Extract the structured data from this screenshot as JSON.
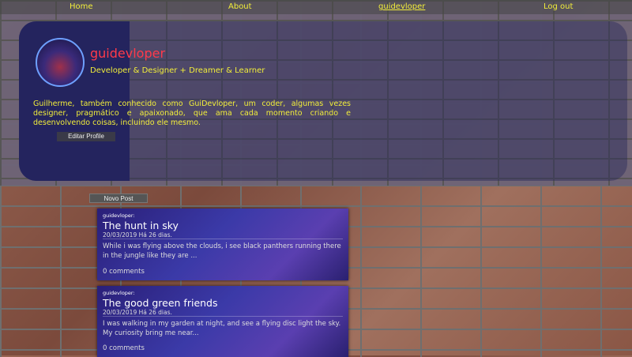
{
  "nav": {
    "items": [
      {
        "label": "Home"
      },
      {
        "label": "About"
      },
      {
        "label": "guidevloper"
      },
      {
        "label": "Log out"
      }
    ]
  },
  "profile": {
    "username": "guidevloper",
    "tagline": "Developer & Designer + Dreamer & Learner",
    "bio": "Guilherme, também conhecido como GuiDevloper, um coder, algumas vezes designer, pragmático e apaixonado, que ama cada momento criando e desenvolvendo coisas, incluindo ele mesmo.",
    "edit_label": "Editar Profile"
  },
  "feed": {
    "new_post_label": "Novo Post",
    "posts": [
      {
        "author": "guidevloper:",
        "title": "The hunt in sky",
        "date": "20/03/2019 Há 26 dias.",
        "excerpt": "While i was flying above the clouds, i see black panthers running there in the jungle like they are ...",
        "comments": "0 comments"
      },
      {
        "author": "guidevloper:",
        "title": "The good green friends",
        "date": "20/03/2019 Há 26 dias.",
        "excerpt": "I was walking in my garden at night, and see a flying disc light the sky. My curiosity bring me near...",
        "comments": "0 comments"
      }
    ]
  }
}
